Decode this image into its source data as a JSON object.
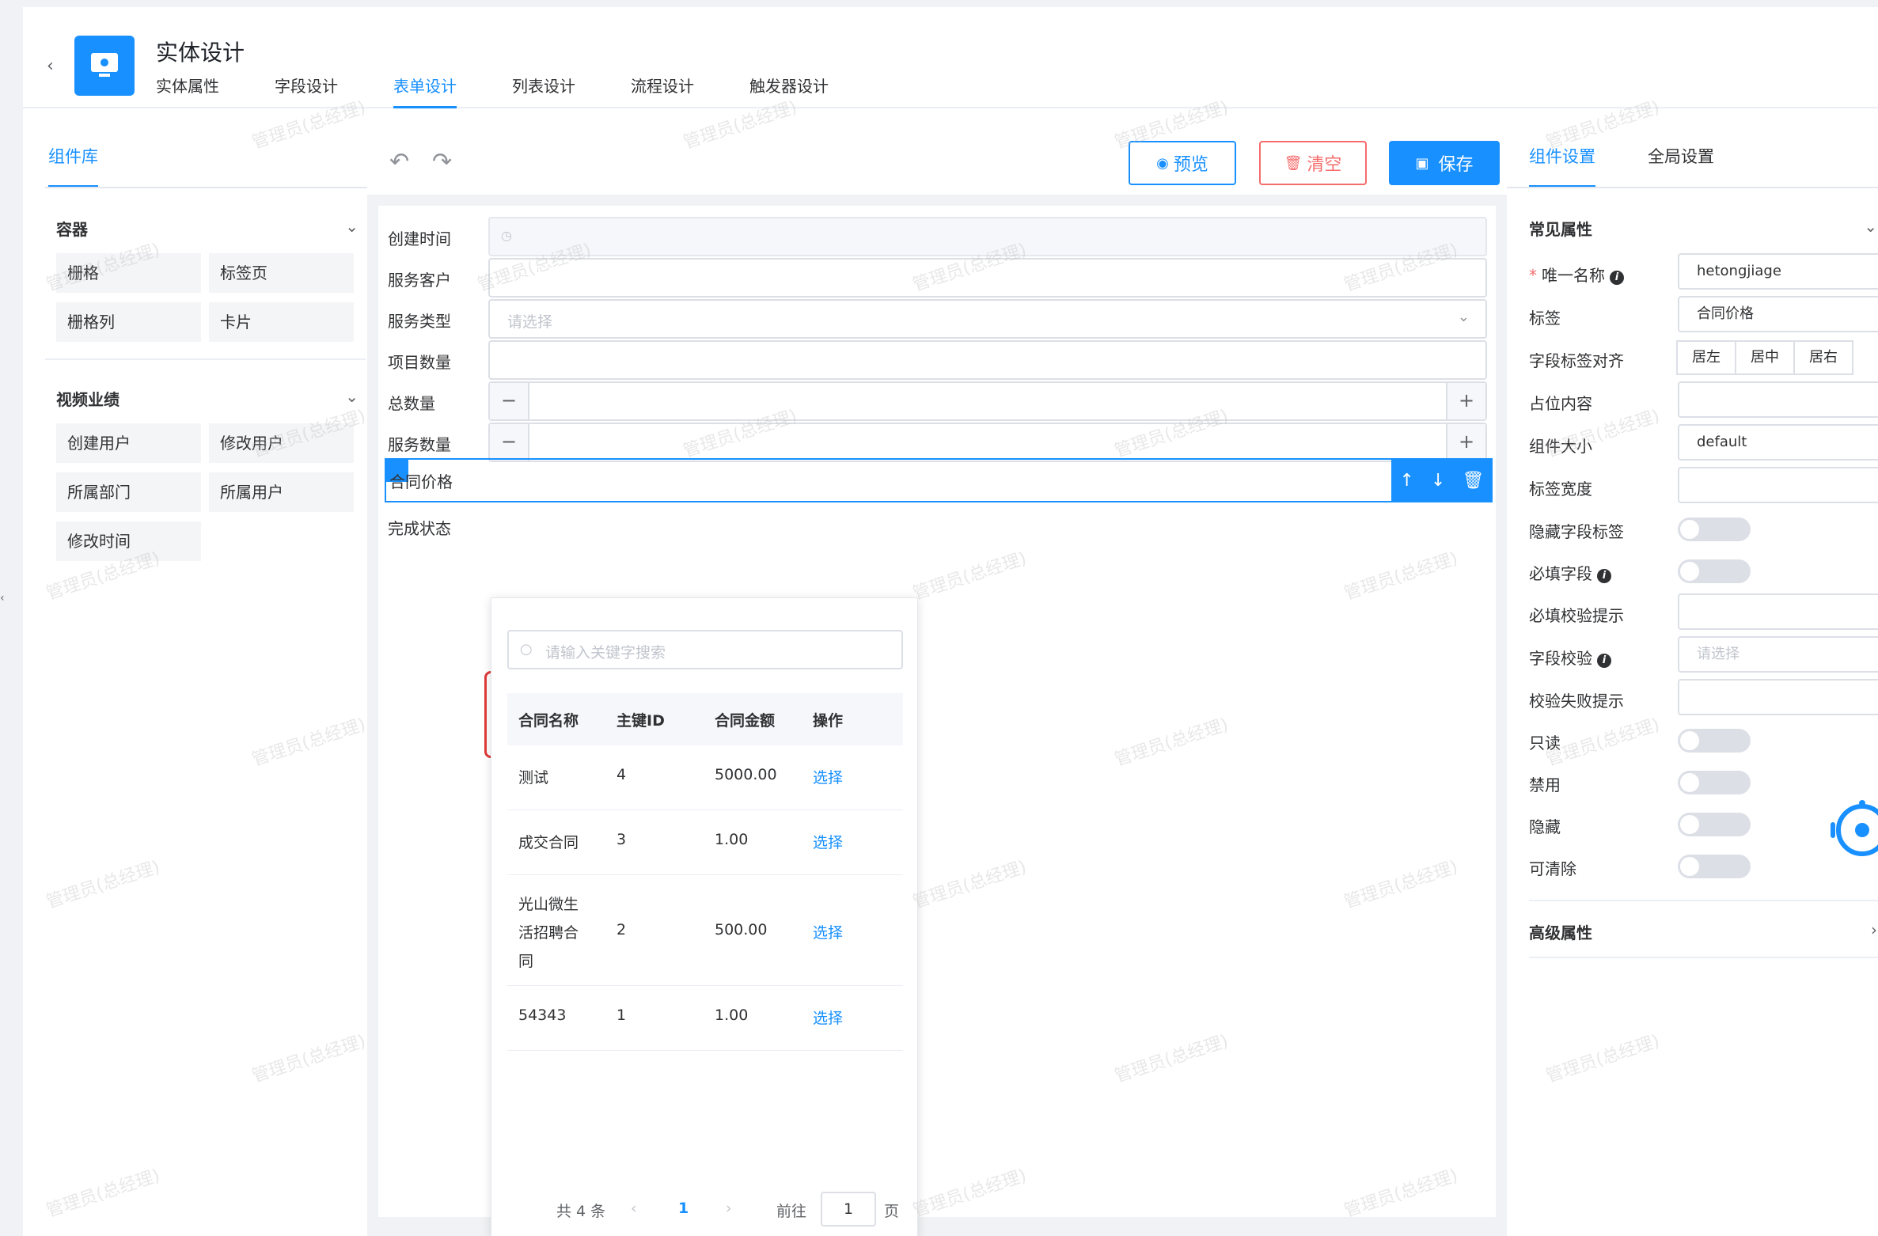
{
  "header": {
    "title": "实体设计",
    "tabs": [
      {
        "label": "实体属性"
      },
      {
        "label": "字段设计"
      },
      {
        "label": "表单设计"
      },
      {
        "label": "列表设计"
      },
      {
        "label": "流程设计"
      },
      {
        "label": "触发器设计"
      }
    ],
    "active_tab": "表单设计"
  },
  "library": {
    "tab": "组件库",
    "groups": [
      {
        "title": "容器",
        "items": [
          "栅格",
          "标签页",
          "栅格列",
          "卡片"
        ]
      },
      {
        "title": "视频业绩",
        "items": [
          "创建用户",
          "修改用户",
          "所属部门",
          "所属用户",
          "修改时间"
        ]
      }
    ]
  },
  "toolbar": {
    "undo_icon": "undo-icon",
    "redo_icon": "redo-icon",
    "preview_label": "预览",
    "clear_label": "清空",
    "save_label": "保存"
  },
  "form": {
    "fields": [
      {
        "label": "创建时间",
        "kind": "datetime-disabled"
      },
      {
        "label": "服务客户",
        "kind": "text"
      },
      {
        "label": "服务类型",
        "kind": "select",
        "placeholder": "请选择"
      },
      {
        "label": "项目数量",
        "kind": "text"
      },
      {
        "label": "总数量",
        "kind": "stepper",
        "minus": "−",
        "plus": "+"
      },
      {
        "label": "服务数量",
        "kind": "stepper",
        "minus": "−",
        "plus": "+"
      },
      {
        "label": "合同价格",
        "kind": "selected"
      },
      {
        "label": "完成状态",
        "kind": "plain"
      }
    ]
  },
  "popover": {
    "search_placeholder": "请输入关键字搜索",
    "columns": [
      "合同名称",
      "主键ID",
      "合同金额",
      "操作"
    ],
    "rows": [
      {
        "name": "测试",
        "id": "4",
        "amount": "5000.00",
        "action": "选择"
      },
      {
        "name": "成交合同",
        "id": "3",
        "amount": "1.00",
        "action": "选择"
      },
      {
        "name_lines": [
          "光山微生",
          "活招聘合",
          "同"
        ],
        "id": "2",
        "amount": "500.00",
        "action": "选择"
      },
      {
        "name": "54343",
        "id": "1",
        "amount": "1.00",
        "action": "选择"
      }
    ],
    "pager": {
      "total": "共 4 条",
      "current": "1",
      "goto": "前往",
      "page_input": "1",
      "page_suffix": "页"
    }
  },
  "settings": {
    "tabs": [
      {
        "label": "组件设置"
      },
      {
        "label": "全局设置"
      }
    ],
    "common_title": "常见属性",
    "advanced_title": "高级属性",
    "rows": {
      "unique_name": {
        "label": "唯一名称",
        "value": "hetongjiage"
      },
      "tag": {
        "label": "标签",
        "value": "合同价格"
      },
      "align": {
        "label": "字段标签对齐",
        "options": [
          "居左",
          "居中",
          "居右"
        ]
      },
      "placeholder": {
        "label": "占位内容"
      },
      "size": {
        "label": "组件大小",
        "value": "default"
      },
      "label_width": {
        "label": "标签宽度"
      },
      "hide_label": {
        "label": "隐藏字段标签"
      },
      "required": {
        "label": "必填字段"
      },
      "required_tip": {
        "label": "必填校验提示"
      },
      "validate": {
        "label": "字段校验",
        "placeholder": "请选择"
      },
      "validate_fail": {
        "label": "校验失败提示"
      },
      "readonly": {
        "label": "只读"
      },
      "disabled": {
        "label": "禁用"
      },
      "hidden": {
        "label": "隐藏"
      },
      "clearable": {
        "label": "可清除"
      }
    }
  },
  "watermark": "管理员(总经理)",
  "colors": {
    "primary": "#1890ff",
    "danger": "#f56c6c",
    "highlight": "#e03a3a"
  }
}
